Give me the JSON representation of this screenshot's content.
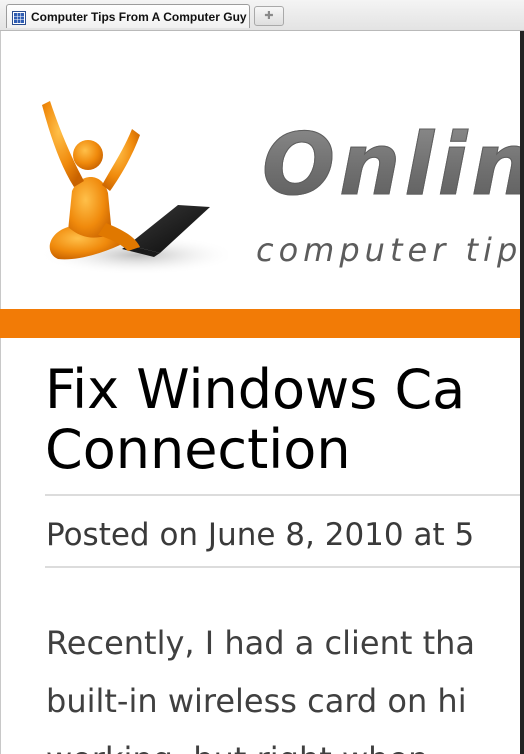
{
  "browser": {
    "tab_title": "Computer Tips From A Computer Guy",
    "favicon": "grid-favicon-icon",
    "new_tab_icon": "new-tab-icon"
  },
  "site": {
    "logo_text": "Onlin",
    "tagline": "computer  tip",
    "accent_color": "#f27b06"
  },
  "post": {
    "title_line1": "Fix Windows Ca",
    "title_line2": "Connection",
    "meta": "Posted on June 8, 2010 at 5",
    "body_lines": [
      "Recently, I had a client tha",
      "built-in wireless card on hi",
      "working, but right when"
    ]
  }
}
